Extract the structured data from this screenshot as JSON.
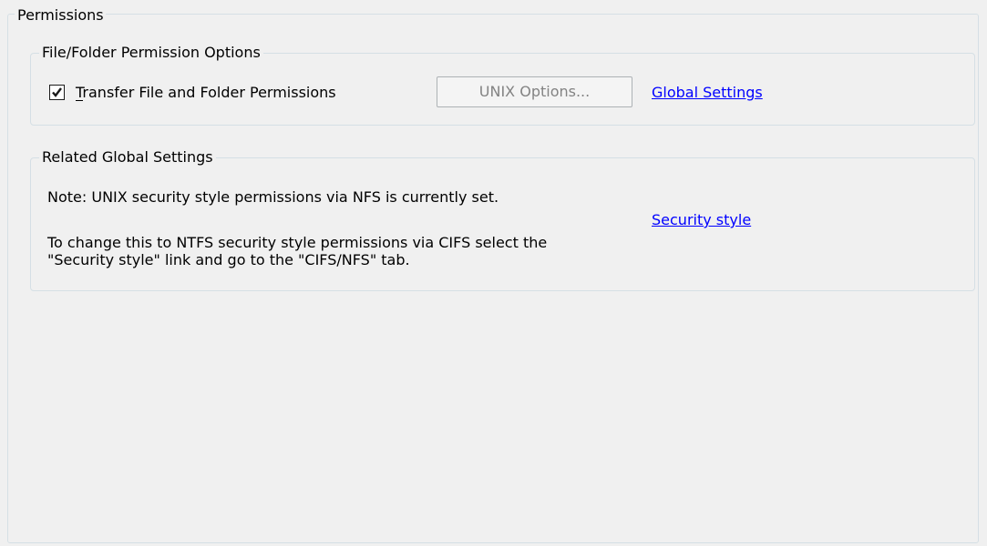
{
  "permissions": {
    "title": "Permissions",
    "file_folder_options": {
      "title": "File/Folder Permission Options",
      "transfer_checkbox": {
        "label": "Transfer File and Folder Permissions",
        "checked": true
      },
      "unix_options_button": "UNIX Options...",
      "global_settings_link": "Global Settings"
    },
    "related_global_settings": {
      "title": "Related Global Settings",
      "note": "Note: UNIX security style permissions via NFS is currently set.",
      "instruction_line1": "To change this to NTFS security style permissions via CIFS select the",
      "instruction_line2": "\"Security style\" link and go to the \"CIFS/NFS\" tab.",
      "security_style_link": "Security style"
    }
  }
}
